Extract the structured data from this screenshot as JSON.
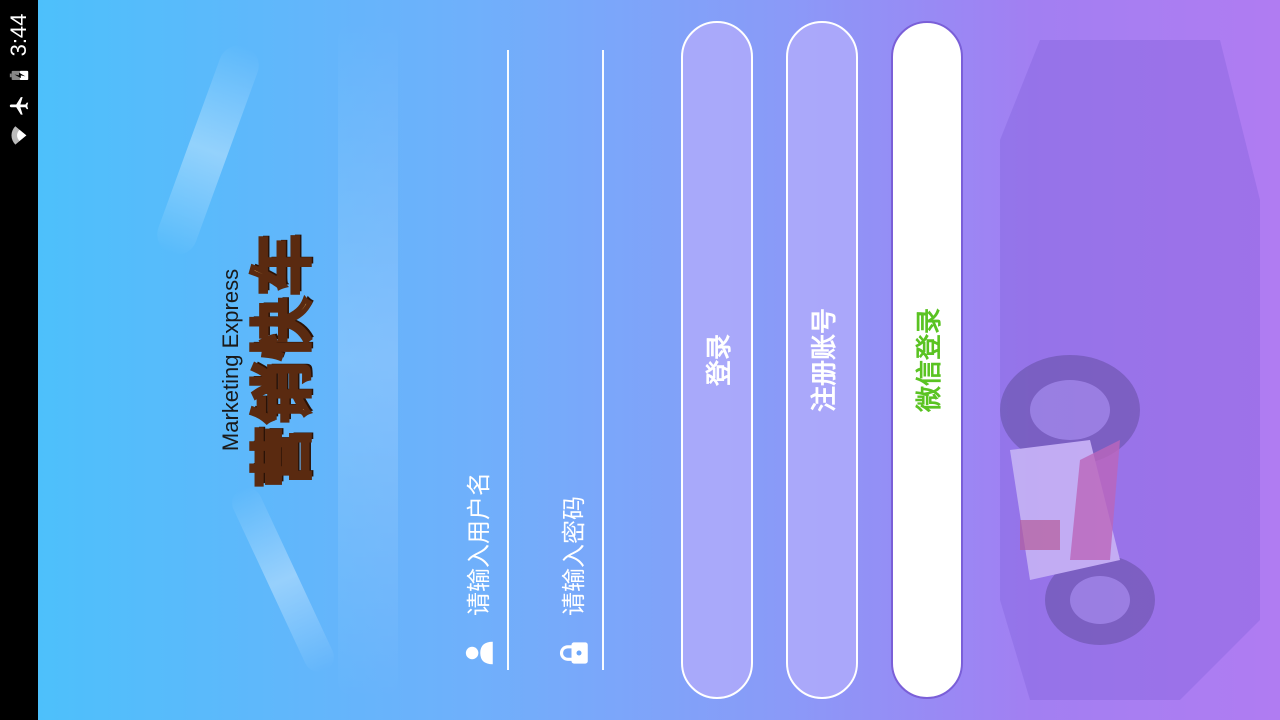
{
  "status_bar": {
    "time": "3:44",
    "icons": [
      "wifi-icon",
      "airplane-mode-icon",
      "battery-charging-icon"
    ]
  },
  "logo": {
    "subtitle": "Marketing Express",
    "title": "营销快车"
  },
  "form": {
    "username": {
      "placeholder": "请输入用户名",
      "value": "",
      "icon": "user-icon"
    },
    "password": {
      "placeholder": "请输入密码",
      "value": "",
      "icon": "lock-icon"
    }
  },
  "buttons": {
    "login": "登录",
    "register": "注册账号",
    "wechat_login": "微信登录"
  },
  "colors": {
    "gradient_start": "#4dc0fb",
    "gradient_end": "#b07cf2",
    "wechat_green": "#5ac322",
    "button_fill": "#afaafa"
  }
}
